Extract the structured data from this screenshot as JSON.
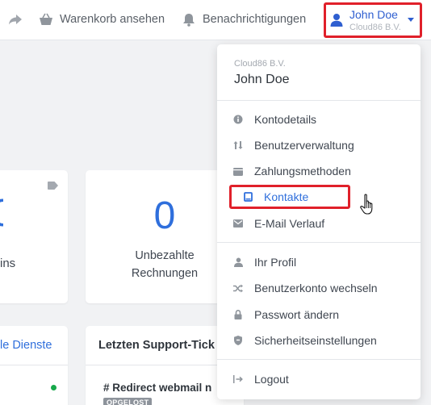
{
  "topbar": {
    "cart_label": "Warenkorb ansehen",
    "notifications_label": "Benachrichtigungen",
    "user": {
      "name": "John Doe",
      "company": "Cloud86 B.V."
    }
  },
  "dashboard": {
    "card_partial_label": "ins",
    "unpaid": {
      "value": "0",
      "label_line1": "Unbezahlte",
      "label_line2": "Rechnungen"
    },
    "services_link": "le Dienste",
    "support": {
      "title": "Letzten Support-Tick",
      "ticket_title": "# Redirect webmail n",
      "ticket_status": "OPGELOST"
    }
  },
  "dropdown": {
    "company": "Cloud86 B.V.",
    "name": "John Doe",
    "items": [
      {
        "label": "Kontodetails",
        "icon": "info-circle-icon"
      },
      {
        "label": "Benutzerverwaltung",
        "icon": "sort-arrows-icon"
      },
      {
        "label": "Zahlungsmethoden",
        "icon": "wallet-icon"
      },
      {
        "label": "Kontakte",
        "icon": "contact-card-icon"
      },
      {
        "label": "E-Mail Verlauf",
        "icon": "envelope-icon"
      },
      {
        "label": "Ihr Profil",
        "icon": "user-icon"
      },
      {
        "label": "Benutzerkonto wechseln",
        "icon": "shuffle-icon"
      },
      {
        "label": "Passwort ändern",
        "icon": "lock-icon"
      },
      {
        "label": "Sicherheitseinstellungen",
        "icon": "shield-icon"
      },
      {
        "label": "Logout",
        "icon": "logout-icon"
      }
    ]
  },
  "colors": {
    "accent": "#2f6fdc",
    "highlight": "#e0202a",
    "status_ok": "#17a84a"
  }
}
